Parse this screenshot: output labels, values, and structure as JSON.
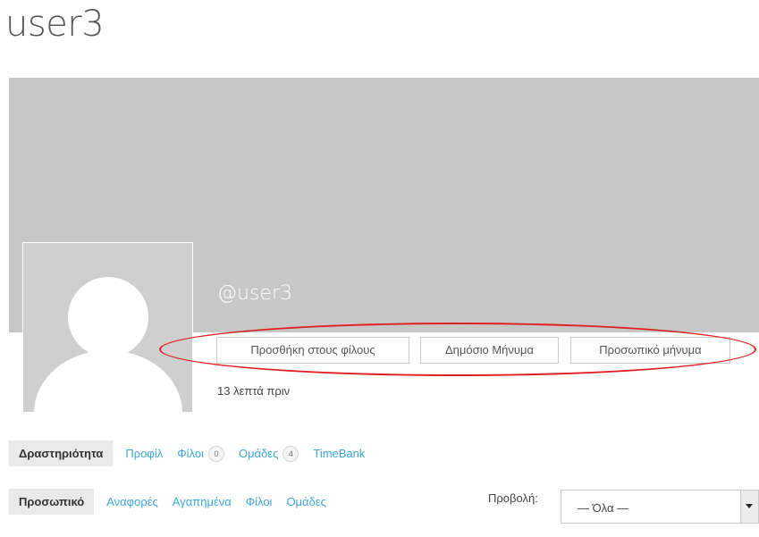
{
  "profile": {
    "title": "user3",
    "handle": "@user3",
    "last_active": "13 λεπτά πριν"
  },
  "actions": {
    "add_friend": "Προσθήκη στους φίλους",
    "public_message": "Δημόσιο Μήνυμα",
    "private_message": "Προσωπικό μήνυμα"
  },
  "main_nav": {
    "activity": "Δραστηριότητα",
    "profile": "Προφίλ",
    "friends": "Φίλοι",
    "friends_count": "0",
    "groups": "Ομάδες",
    "groups_count": "4",
    "timebank": "TimeBank"
  },
  "sub_nav": {
    "personal": "Προσωπικό",
    "mentions": "Αναφορές",
    "favorites": "Αγαπημένα",
    "friends": "Φίλοι",
    "groups": "Ομάδες"
  },
  "filter": {
    "label": "Προβολή:",
    "selected": "— Όλα —"
  },
  "colors": {
    "cover": "#c7c7c7",
    "link": "#3ea7d8",
    "annotation": "#e02020"
  }
}
